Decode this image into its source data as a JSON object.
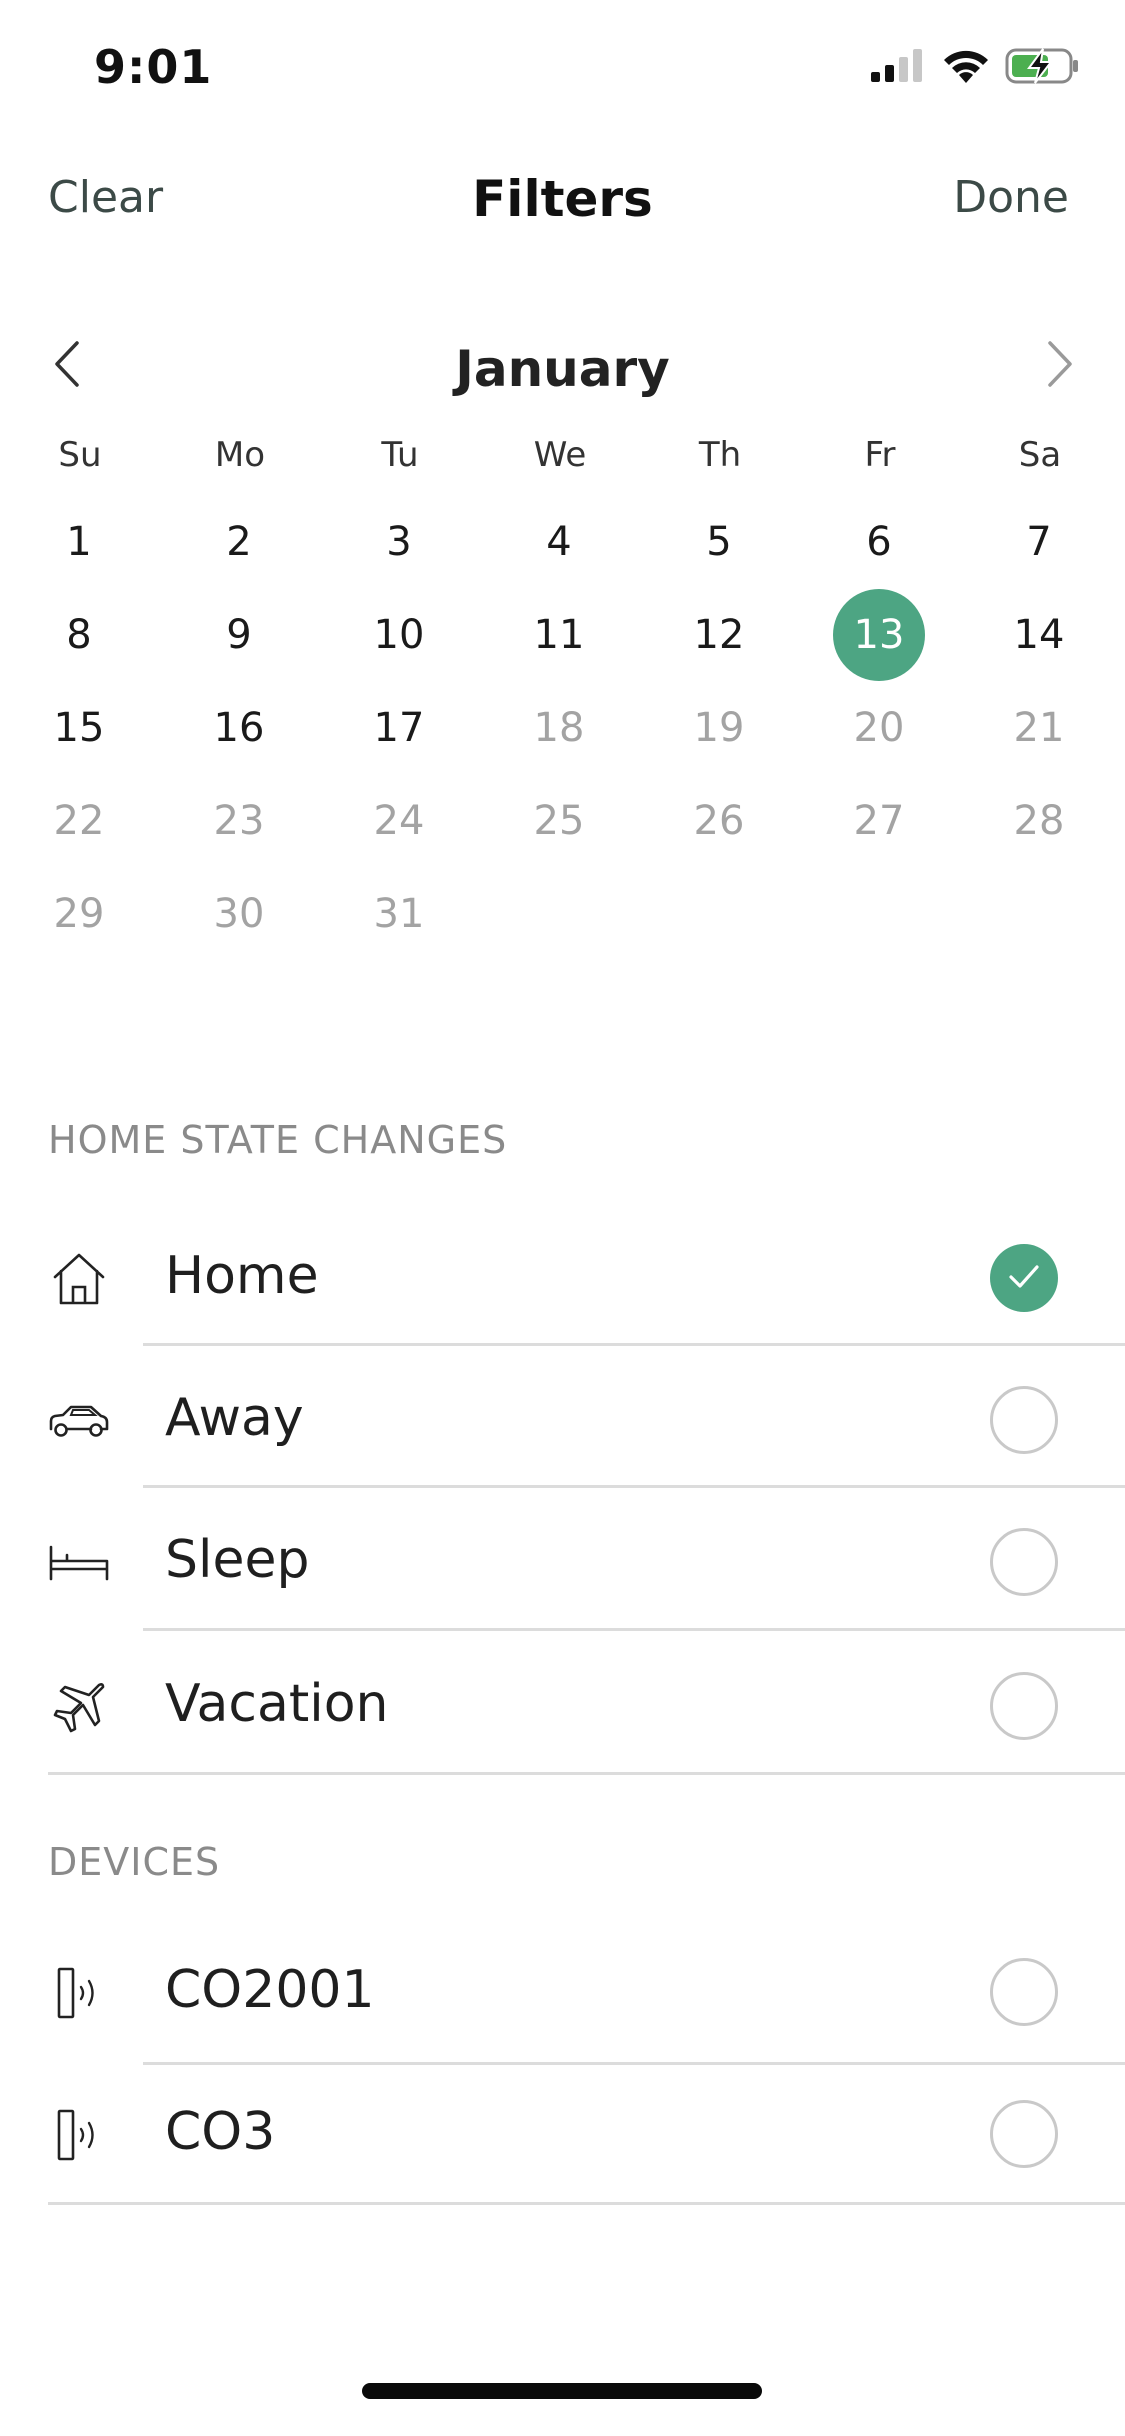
{
  "status_bar": {
    "time": "9:01"
  },
  "nav": {
    "clear_label": "Clear",
    "title": "Filters",
    "done_label": "Done"
  },
  "calendar": {
    "month": "January",
    "weekdays": [
      "Su",
      "Mo",
      "Tu",
      "We",
      "Th",
      "Fr",
      "Sa"
    ],
    "selected_day": "13",
    "weeks": [
      [
        "1",
        "2",
        "3",
        "4",
        "5",
        "6",
        "7"
      ],
      [
        "8",
        "9",
        "10",
        "11",
        "12",
        "13",
        "14"
      ],
      [
        "15",
        "16",
        "17",
        "18",
        "19",
        "20",
        "21"
      ],
      [
        "22",
        "23",
        "24",
        "25",
        "26",
        "27",
        "28"
      ],
      [
        "29",
        "30",
        "31"
      ]
    ],
    "last_enabled_day": 17
  },
  "home_state": {
    "header": "HOME STATE CHANGES",
    "items": [
      {
        "label": "Home",
        "icon": "house-icon",
        "checked": true
      },
      {
        "label": "Away",
        "icon": "car-icon",
        "checked": false
      },
      {
        "label": "Sleep",
        "icon": "bed-icon",
        "checked": false
      },
      {
        "label": "Vacation",
        "icon": "airplane-icon",
        "checked": false
      }
    ]
  },
  "devices": {
    "header": "DEVICES",
    "items": [
      {
        "label": "CO2001",
        "icon": "sensor-icon",
        "checked": false
      },
      {
        "label": "CO3",
        "icon": "sensor-icon",
        "checked": false
      }
    ]
  },
  "colors": {
    "accent": "#4da583",
    "muted_text": "#a3a3a3",
    "nav_text": "#3c4a47"
  }
}
